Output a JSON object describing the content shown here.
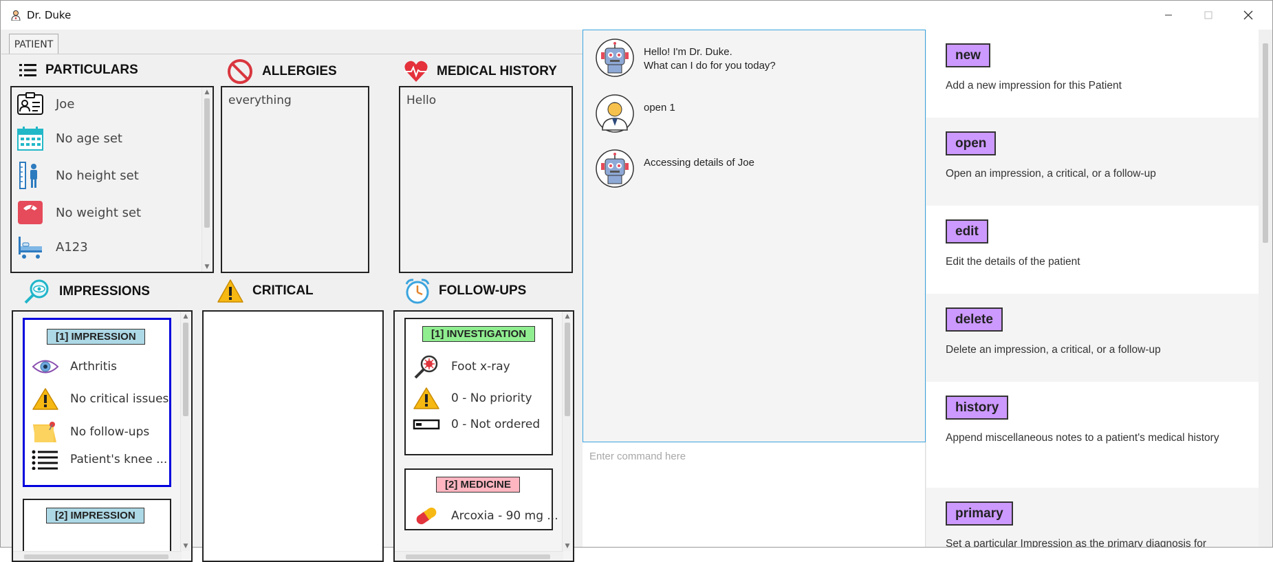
{
  "window": {
    "title": "Dr. Duke"
  },
  "tabs": {
    "patient": "PATIENT"
  },
  "sections": {
    "particulars": "PARTICULARS",
    "allergies": "ALLERGIES",
    "medical_history": "MEDICAL HISTORY",
    "impressions": "IMPRESSIONS",
    "critical": "CRITICAL",
    "followups": "FOLLOW-UPS"
  },
  "particulars": {
    "name": "Joe",
    "age": "No age set",
    "height": "No height set",
    "weight": "No weight set",
    "bed": "A123"
  },
  "allergies": {
    "text": "everything"
  },
  "medical_history": {
    "text": "Hello"
  },
  "impressions": {
    "card1": {
      "tag": "[1] IMPRESSION",
      "description": "Arthritis",
      "critical": "No critical issues",
      "followups": "No follow-ups",
      "notes": "Patient's knee ..."
    },
    "card2": {
      "tag": "[2] IMPRESSION"
    }
  },
  "followups": {
    "card1": {
      "tag": "[1] INVESTIGATION",
      "name": "Foot x-ray",
      "priority": "0 - No priority",
      "status": "0 - Not ordered"
    },
    "card2": {
      "tag": "[2] MEDICINE",
      "name": "Arcoxia - 90 mg ..."
    }
  },
  "chat": {
    "messages": [
      {
        "sender": "bot",
        "line1": "Hello! I'm Dr. Duke.",
        "line2": "What can I do for you today?"
      },
      {
        "sender": "user",
        "line1": "open 1",
        "line2": ""
      },
      {
        "sender": "bot",
        "line1": "Accessing details of Joe",
        "line2": ""
      }
    ],
    "input_placeholder": "Enter command here"
  },
  "help": [
    {
      "command": "new",
      "description": "Add a new impression for this Patient"
    },
    {
      "command": "open",
      "description": "Open an impression, a critical, or a follow-up"
    },
    {
      "command": "edit",
      "description": "Edit the details of the patient"
    },
    {
      "command": "delete",
      "description": "Delete an impression, a critical, or a follow-up"
    },
    {
      "command": "history",
      "description": "Append miscellaneous notes to a patient's medical history"
    },
    {
      "command": "primary",
      "description": "Set a particular Impression as the primary diagnosis for"
    }
  ],
  "colors": {
    "impression_tag": "#add8e6",
    "investigation_tag": "#90ee90",
    "medicine_tag": "#ffb6c1",
    "command_badge": "#cc99ff",
    "selected_card_border": "#0000dd",
    "chat_border": "#39a3e0"
  }
}
